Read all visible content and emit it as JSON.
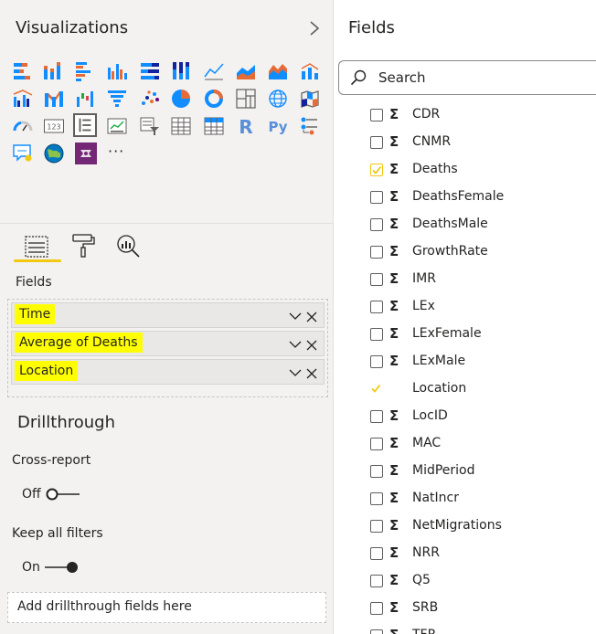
{
  "visualizations": {
    "title": "Visualizations",
    "more_label": "···",
    "icons": [
      "stacked-bar-chart-icon",
      "stacked-column-chart-icon",
      "clustered-bar-chart-icon",
      "clustered-column-chart-icon",
      "100-stacked-bar-chart-icon",
      "100-stacked-column-chart-icon",
      "line-chart-icon",
      "area-chart-icon",
      "stacked-area-chart-icon",
      "line-and-stacked-column-chart-icon",
      "line-and-clustered-column-chart-icon",
      "ribbon-chart-icon",
      "waterfall-chart-icon",
      "funnel-chart-icon",
      "scatter-chart-icon",
      "pie-chart-icon",
      "donut-chart-icon",
      "treemap-icon",
      "map-icon",
      "filled-map-icon",
      "gauge-icon",
      "card-icon",
      "multi-row-card-icon",
      "kpi-icon",
      "slicer-icon",
      "table-icon",
      "matrix-icon",
      "r-script-visual-icon",
      "python-visual-icon",
      "key-influencers-icon",
      "qa-visual-icon",
      "arcgis-map-icon",
      "power-apps-icon",
      "more-visuals-icon"
    ],
    "card_text": "123",
    "r_text": "R",
    "py_text": "Py"
  },
  "fields_section": {
    "label": "Fields",
    "wells": [
      {
        "label": "Time"
      },
      {
        "label": "Average of Deaths"
      },
      {
        "label": "Location"
      }
    ]
  },
  "drillthrough": {
    "title": "Drillthrough",
    "cross_report_label": "Cross-report",
    "cross_report_state": "Off",
    "keep_filters_label": "Keep all filters",
    "keep_filters_state": "On",
    "drop_placeholder": "Add drillthrough fields here"
  },
  "fields_pane": {
    "title": "Fields",
    "search_placeholder": "Search",
    "sigma": "Σ",
    "items": [
      {
        "name": "CDR",
        "checked": false,
        "sigma": true
      },
      {
        "name": "CNMR",
        "checked": false,
        "sigma": true
      },
      {
        "name": "Deaths",
        "checked": true,
        "sigma": true
      },
      {
        "name": "DeathsFemale",
        "checked": false,
        "sigma": true
      },
      {
        "name": "DeathsMale",
        "checked": false,
        "sigma": true
      },
      {
        "name": "GrowthRate",
        "checked": false,
        "sigma": true
      },
      {
        "name": "IMR",
        "checked": false,
        "sigma": true
      },
      {
        "name": "LEx",
        "checked": false,
        "sigma": true
      },
      {
        "name": "LExFemale",
        "checked": false,
        "sigma": true
      },
      {
        "name": "LExMale",
        "checked": false,
        "sigma": true
      },
      {
        "name": "Location",
        "checked": true,
        "sigma": false
      },
      {
        "name": "LocID",
        "checked": false,
        "sigma": true
      },
      {
        "name": "MAC",
        "checked": false,
        "sigma": true
      },
      {
        "name": "MidPeriod",
        "checked": false,
        "sigma": true
      },
      {
        "name": "NatIncr",
        "checked": false,
        "sigma": true
      },
      {
        "name": "NetMigrations",
        "checked": false,
        "sigma": true
      },
      {
        "name": "NRR",
        "checked": false,
        "sigma": true
      },
      {
        "name": "Q5",
        "checked": false,
        "sigma": true
      },
      {
        "name": "SRB",
        "checked": false,
        "sigma": true
      },
      {
        "name": "TFR",
        "checked": false,
        "sigma": true
      }
    ]
  },
  "colors": {
    "accent_yellow": "#f2c811",
    "highlight": "#ffff00",
    "chart_blue": "#118dff",
    "chart_orange": "#e66c37",
    "chart_navy": "#12239e",
    "chart_purple": "#6b007b"
  }
}
